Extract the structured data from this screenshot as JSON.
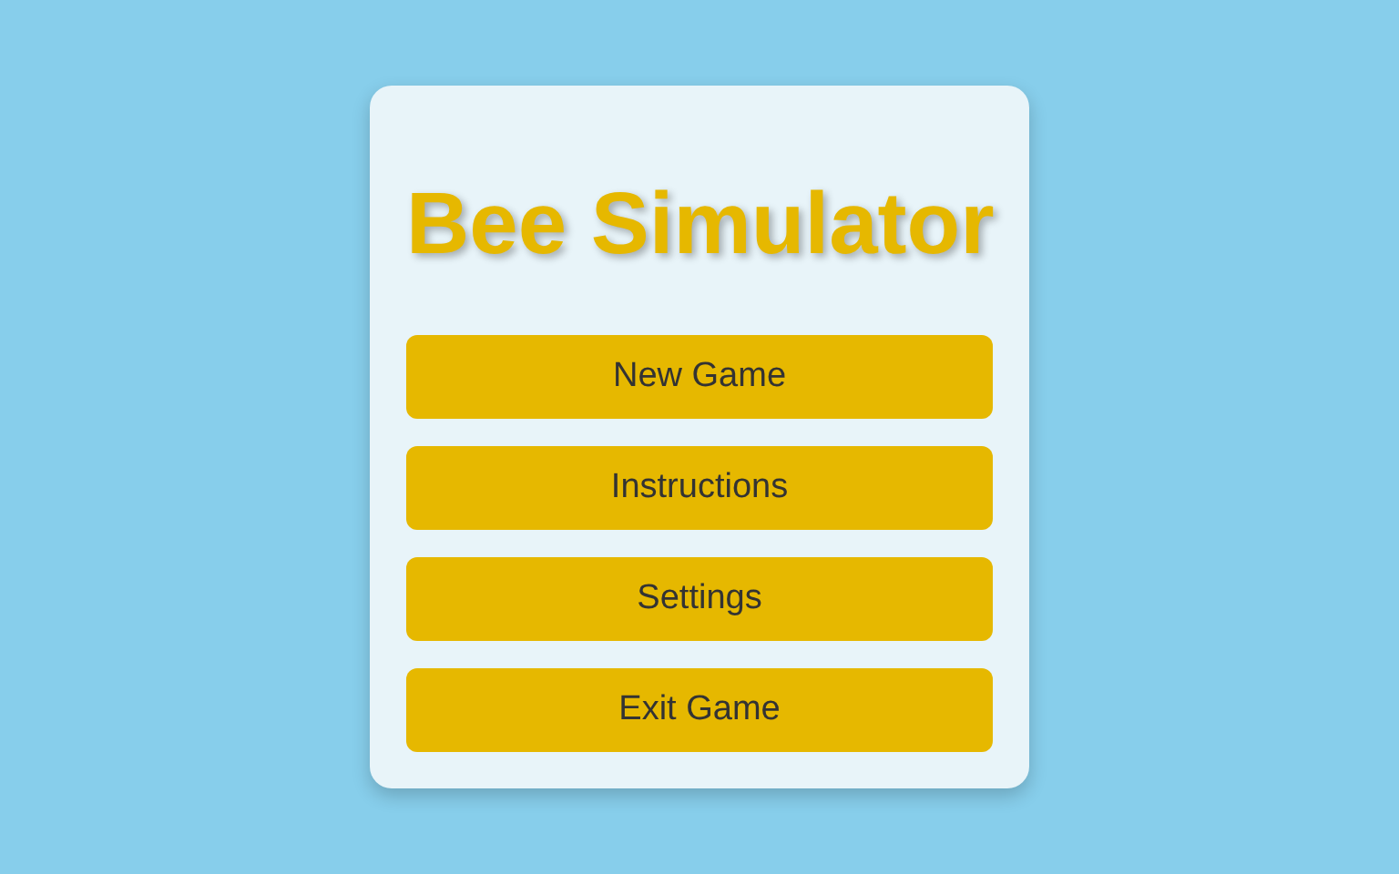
{
  "title": "Bee Simulator",
  "menu": [
    {
      "label": "New Game"
    },
    {
      "label": "Instructions"
    },
    {
      "label": "Settings"
    },
    {
      "label": "Exit Game"
    }
  ]
}
